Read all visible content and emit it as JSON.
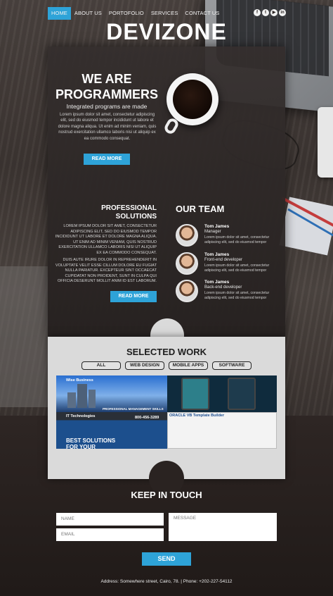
{
  "nav": {
    "items": [
      "HOME",
      "ABOUT US",
      "PORTOFOLIO",
      "SERVICES",
      "CONTACT US"
    ],
    "active": "HOME",
    "socials": [
      "facebook-icon",
      "twitter-icon",
      "youtube-icon",
      "linkedin-icon"
    ],
    "social_glyphs": [
      "f",
      "t",
      "▶",
      "in"
    ]
  },
  "logo": "DEVIZONE",
  "hero": {
    "title": "WE ARE PROGRAMMERS",
    "subtitle": "Integrated programs are made",
    "text": "Lorem ipsum dolor sit amet, consectetur adipiscing elit, sed do eiusmod tempor incididunt ut labore et dolore magna aliqua. Ut enim ad minim veniam, quis nostrud exercitation ullamco laboris nisi ut aliquip ex ea commodo consequat.",
    "button": "READ MORE"
  },
  "professional": {
    "title": "PROFESSIONAL SOLUTIONS",
    "p1": "Lorem ipsum dolor sit amet, consectetur adipiscing elit, sed do eiusmod tempor incididunt ut labore et dolore magna aliqua. Ut enim ad minim veniam, quis nostrud exercitation ullamco laboris nisi ut aliquip ex ea commodo consequat.",
    "p2": "Duis aute irure dolor in reprehenderit in voluptate velit esse cillum dolore eu fugiat nulla pariatur. Excepteur sint occaecat cupidatat non proident, sunt in culpa qui officia deserunt mollit anim id est laborum.",
    "button": "READ MORE"
  },
  "team": {
    "title": "OUR TEAM",
    "members": [
      {
        "name": "Tom James",
        "role": "Manager",
        "text": "Lorem ipsum dolor sit amet, consectetur adipiscing elit, sed do eiusmod tempor"
      },
      {
        "name": "Tom James",
        "role": "Front-end developer",
        "text": "Lorem ipsum dolor sit amet, consectetur adipiscing elit, sed do eiusmod tempor"
      },
      {
        "name": "Tom James",
        "role": "Back-end developer",
        "text": "Lorem ipsum dolor sit amet, consectetur adipiscing elit, sed do eiusmod tempor"
      }
    ]
  },
  "work": {
    "title": "SELECTED WORK",
    "filters": [
      "ALL",
      "WEB DESIGN",
      "MOBILE APPS",
      "SOFTWARE"
    ],
    "shots": {
      "s1": "Wise Business",
      "s1b": "PROFESSIONAL MANAGEMENT SKILLS",
      "s3": "IT Technologies",
      "s3phone": "800-456-3289",
      "s3big": "BEST SOLUTIONS FOR YOUR BUSINESS!",
      "s4": "ORACLE VB Template Builder"
    }
  },
  "contact": {
    "title": "KEEP IN TOUCH",
    "name_placeholder": "NAME",
    "email_placeholder": "EMAIL",
    "message_placeholder": "MESSAGE",
    "button": "SEND",
    "footer": "Address: Somewhere street, Cairo, 78. | Phone: +202-227-54112"
  },
  "colors": {
    "accent": "#2ea3d8",
    "dark": "#2b2422",
    "light": "#dadada"
  }
}
